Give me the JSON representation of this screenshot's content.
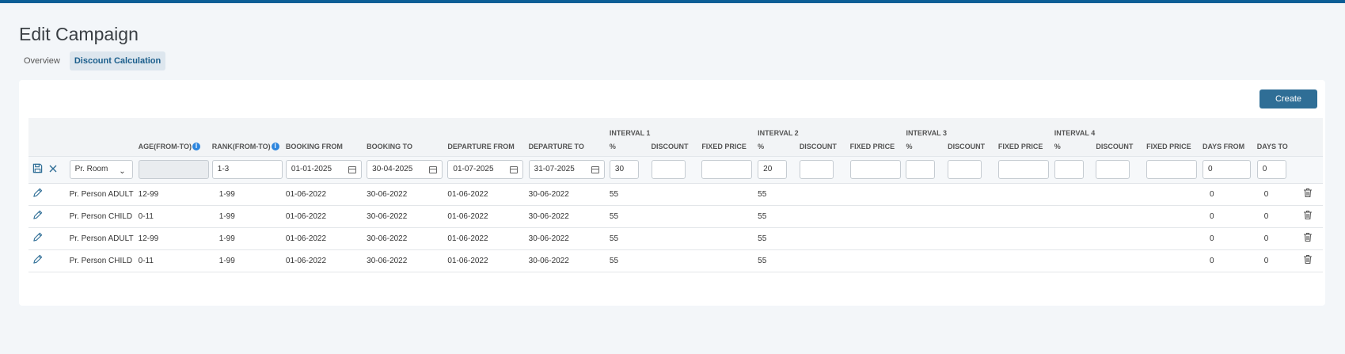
{
  "page": {
    "title": "Edit Campaign"
  },
  "tabs": [
    {
      "label": "Overview",
      "active": false
    },
    {
      "label": "Discount Calculation",
      "active": true
    }
  ],
  "toolbar": {
    "create_label": "Create"
  },
  "table": {
    "interval_groups": [
      "INTERVAL 1",
      "INTERVAL 2",
      "INTERVAL 3",
      "INTERVAL 4"
    ],
    "headers": {
      "age": "AGE(FROM-TO)",
      "rank": "RANK(FROM-TO)",
      "booking_from": "BOOKING FROM",
      "booking_to": "BOOKING TO",
      "departure_from": "DEPARTURE FROM",
      "departure_to": "DEPARTURE TO",
      "percent": "%",
      "discount": "DISCOUNT",
      "fixed_price": "FIXED PRICE",
      "days_from": "DAYS FROM",
      "days_to": "DAYS TO"
    },
    "edit_row": {
      "type_value": "Pr. Room",
      "age_value": "",
      "rank_value": "1-3",
      "booking_from": "01-01-2025",
      "booking_to": "30-04-2025",
      "departure_from": "01-07-2025",
      "departure_to": "31-07-2025",
      "i1_percent": "30",
      "i2_percent": "20",
      "days_from": "0",
      "days_to": "0"
    },
    "rows": [
      {
        "type": "Pr. Person ADULT",
        "age": "12-99",
        "rank": "1-99",
        "booking_from": "01-06-2022",
        "booking_to": "30-06-2022",
        "departure_from": "01-06-2022",
        "departure_to": "30-06-2022",
        "i1_percent": "55",
        "i2_percent": "55",
        "days_from": "0",
        "days_to": "0"
      },
      {
        "type": "Pr. Person CHILD",
        "age": "0-11",
        "rank": "1-99",
        "booking_from": "01-06-2022",
        "booking_to": "30-06-2022",
        "departure_from": "01-06-2022",
        "departure_to": "30-06-2022",
        "i1_percent": "55",
        "i2_percent": "55",
        "days_from": "0",
        "days_to": "0"
      },
      {
        "type": "Pr. Person ADULT",
        "age": "12-99",
        "rank": "1-99",
        "booking_from": "01-06-2022",
        "booking_to": "30-06-2022",
        "departure_from": "01-06-2022",
        "departure_to": "30-06-2022",
        "i1_percent": "55",
        "i2_percent": "55",
        "days_from": "0",
        "days_to": "0"
      },
      {
        "type": "Pr. Person CHILD",
        "age": "0-11",
        "rank": "1-99",
        "booking_from": "01-06-2022",
        "booking_to": "30-06-2022",
        "departure_from": "01-06-2022",
        "departure_to": "30-06-2022",
        "i1_percent": "55",
        "i2_percent": "55",
        "days_from": "0",
        "days_to": "0"
      }
    ]
  },
  "icons": {
    "save": "save-icon",
    "cancel": "close-icon",
    "edit": "pencil-icon",
    "delete": "trash-icon",
    "info": "info-icon",
    "calendar": "calendar-icon",
    "chevron": "chevron-down-icon"
  },
  "colors": {
    "topbar": "#0b5e96",
    "accent": "#2f6e96",
    "info": "#2e86de"
  }
}
